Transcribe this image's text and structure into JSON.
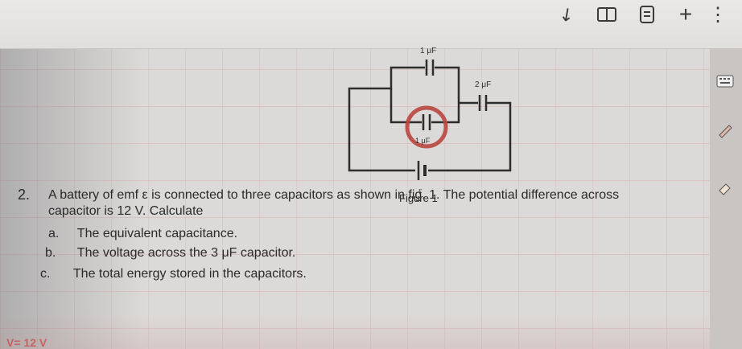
{
  "toolbar": {
    "icons": [
      "collapse-arrow-icon",
      "book-icon",
      "notes-icon",
      "add-icon",
      "more-options-icon"
    ],
    "add_label": "+",
    "more_label": "⋮"
  },
  "figure": {
    "caption": "Figure 1",
    "labels": {
      "top_capacitor": "1 μF",
      "right_capacitor": "2 μF",
      "middle_capacitor": "1 μF",
      "battery": "ε"
    }
  },
  "question": {
    "number": "2.",
    "line1": "A battery of emf ε is connected to three capacitors as shown in fig. 1. The potential difference across",
    "line2": "capacitor is 12 V. Calculate",
    "items": [
      {
        "letter": "a.",
        "text": "The equivalent capacitance."
      },
      {
        "letter": "b.",
        "text": "The voltage across the 3 μF capacitor."
      },
      {
        "letter": "c.",
        "text": "The total energy stored in the capacitors."
      }
    ]
  },
  "handwriting": {
    "bottom_note": "V= 12 V"
  },
  "colors": {
    "paper": "#dcdad8",
    "grid": "#d79d9d",
    "ink": "#2a2a2a",
    "annotation_red": "#b8463e"
  }
}
